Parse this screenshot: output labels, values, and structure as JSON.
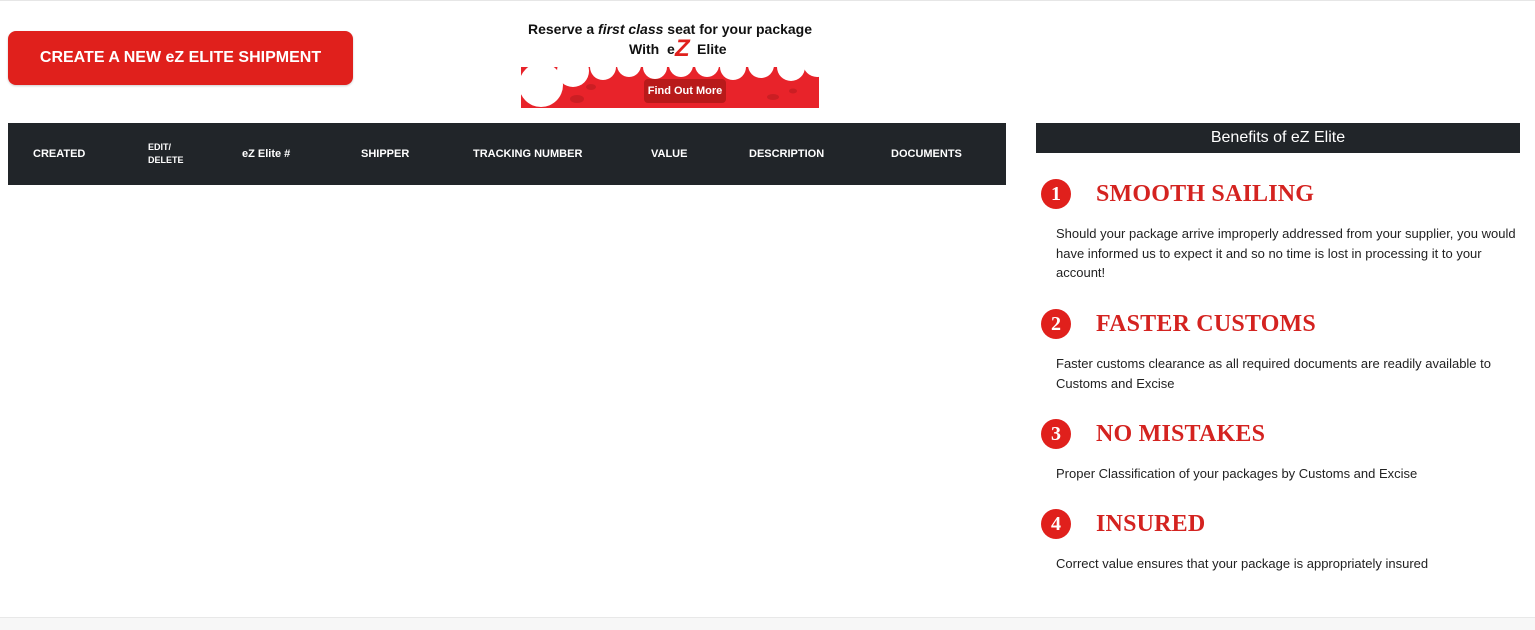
{
  "toolbar": {
    "create_label": "CREATE A NEW eZ ELITE SHIPMENT"
  },
  "banner": {
    "line1_pre": "Reserve a ",
    "line1_em": "first class",
    "line1_post": " seat for your package",
    "line2": "With",
    "logo_e": "e",
    "logo_z": "Z",
    "logo_elite": "Elite",
    "cta": "Find Out More",
    "colors": {
      "accent": "#e0201c",
      "cta": "#b81a1a"
    }
  },
  "table": {
    "columns": {
      "created": "CREATED",
      "edit_line1": "EDIT/",
      "edit_line2": "DELETE",
      "ez_number": "eZ Elite #",
      "shipper": "SHIPPER",
      "tracking": "TRACKING NUMBER",
      "value": "VALUE",
      "description": "DESCRIPTION",
      "documents": "DOCUMENTS"
    },
    "rows": []
  },
  "benefits": {
    "title": "Benefits of eZ Elite",
    "items": [
      {
        "number": "1",
        "heading": "SMOOTH SAILING",
        "text": "Should your package arrive improperly addressed from your supplier, you would have informed us to expect it and so no time is lost in processing it to your account!"
      },
      {
        "number": "2",
        "heading": "FASTER CUSTOMS",
        "text": "Faster customs clearance as all required documents are readily available to Customs and Excise"
      },
      {
        "number": "3",
        "heading": "NO MISTAKES",
        "text": "Proper Classification of your packages by Customs and Excise"
      },
      {
        "number": "4",
        "heading": "INSURED",
        "text": "Correct value ensures that your package is appropriately insured"
      }
    ]
  },
  "colors": {
    "accent": "#e0201c",
    "heading_red": "#d42320",
    "dark": "#212529"
  }
}
